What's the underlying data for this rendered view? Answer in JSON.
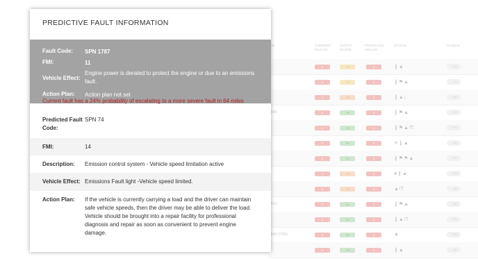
{
  "background_table": {
    "headers": {
      "location": "ION",
      "current_health": "CURRENT HEALTH",
      "safety_score": "SAFETY SCORE",
      "predicted_health": "PREDICTED HEALTH",
      "status": "STATUS",
      "handle": "HANDLE"
    },
    "fragments": [
      "4589",
      "8922",
      "2949 (7250)"
    ],
    "rows": [
      {
        "health": "0",
        "safety": "71",
        "predicted": "0",
        "safety_color": "yellow"
      },
      {
        "health": "0",
        "safety": "71",
        "predicted": "0",
        "safety_color": "yellow"
      },
      {
        "health": "0",
        "safety": "71",
        "predicted": "0",
        "safety_color": "orange"
      },
      {
        "health": "0",
        "safety": "75",
        "predicted": "0",
        "safety_color": "green"
      },
      {
        "health": "0",
        "safety": "75",
        "predicted": "0",
        "safety_color": "green"
      },
      {
        "health": "0",
        "safety": "75",
        "predicted": "0",
        "safety_color": "green"
      },
      {
        "health": "0",
        "safety": "75",
        "predicted": "0",
        "safety_color": "green"
      },
      {
        "health": "0",
        "safety": "71",
        "predicted": "0",
        "safety_color": "orange"
      },
      {
        "health": "0",
        "safety": "71",
        "predicted": "0",
        "safety_color": "orange"
      },
      {
        "health": "0",
        "safety": "75",
        "predicted": "0",
        "safety_color": "green"
      },
      {
        "health": "0",
        "safety": "75",
        "predicted": "0",
        "safety_color": "green"
      },
      {
        "health": "0",
        "safety": "75",
        "predicted": "0",
        "safety_color": "green"
      },
      {
        "health": "0",
        "safety": "75",
        "predicted": "0",
        "safety_color": "green"
      }
    ],
    "toggle_label": "NO"
  },
  "popup": {
    "title": "PREDICTIVE FAULT INFORMATION",
    "current": {
      "fault_code_label": "Fault Code:",
      "fault_code_value": "SPN 1787",
      "fmi_label": "FMI:",
      "fmi_value": "11",
      "vehicle_effect_label": "Vehicle Effect:",
      "vehicle_effect_value": "Engine power is derated to protect the engine or due to an emissions fault.",
      "action_plan_label": "Action Plan:",
      "action_plan_value": "Action plan not set"
    },
    "warning": "Current fault has a 24% probability of escalating to a more severe fault in 64 miles",
    "predicted": {
      "predicted_fault_code_label": "Predicted Fault Code:",
      "predicted_fault_code_value": "SPN 74",
      "fmi_label": "FMI:",
      "fmi_value": "14",
      "description_label": "Description:",
      "description_value": "Emission control system - Vehicle speed limitation active",
      "vehicle_effect_label": "Vehicle Effect:",
      "vehicle_effect_value": "Emissions Fault light -Vehicle speed limited.",
      "action_plan_label": "Action Plan:",
      "action_plan_value": "If the vehicle is currently carrying a load and the driver can maintain safe vehicle speeds, then the driver may be able to deliver the load. Vehicle should be brought into a repair facility for professional diagnosis and repair as soon as convenient to prevent engine damage."
    }
  }
}
